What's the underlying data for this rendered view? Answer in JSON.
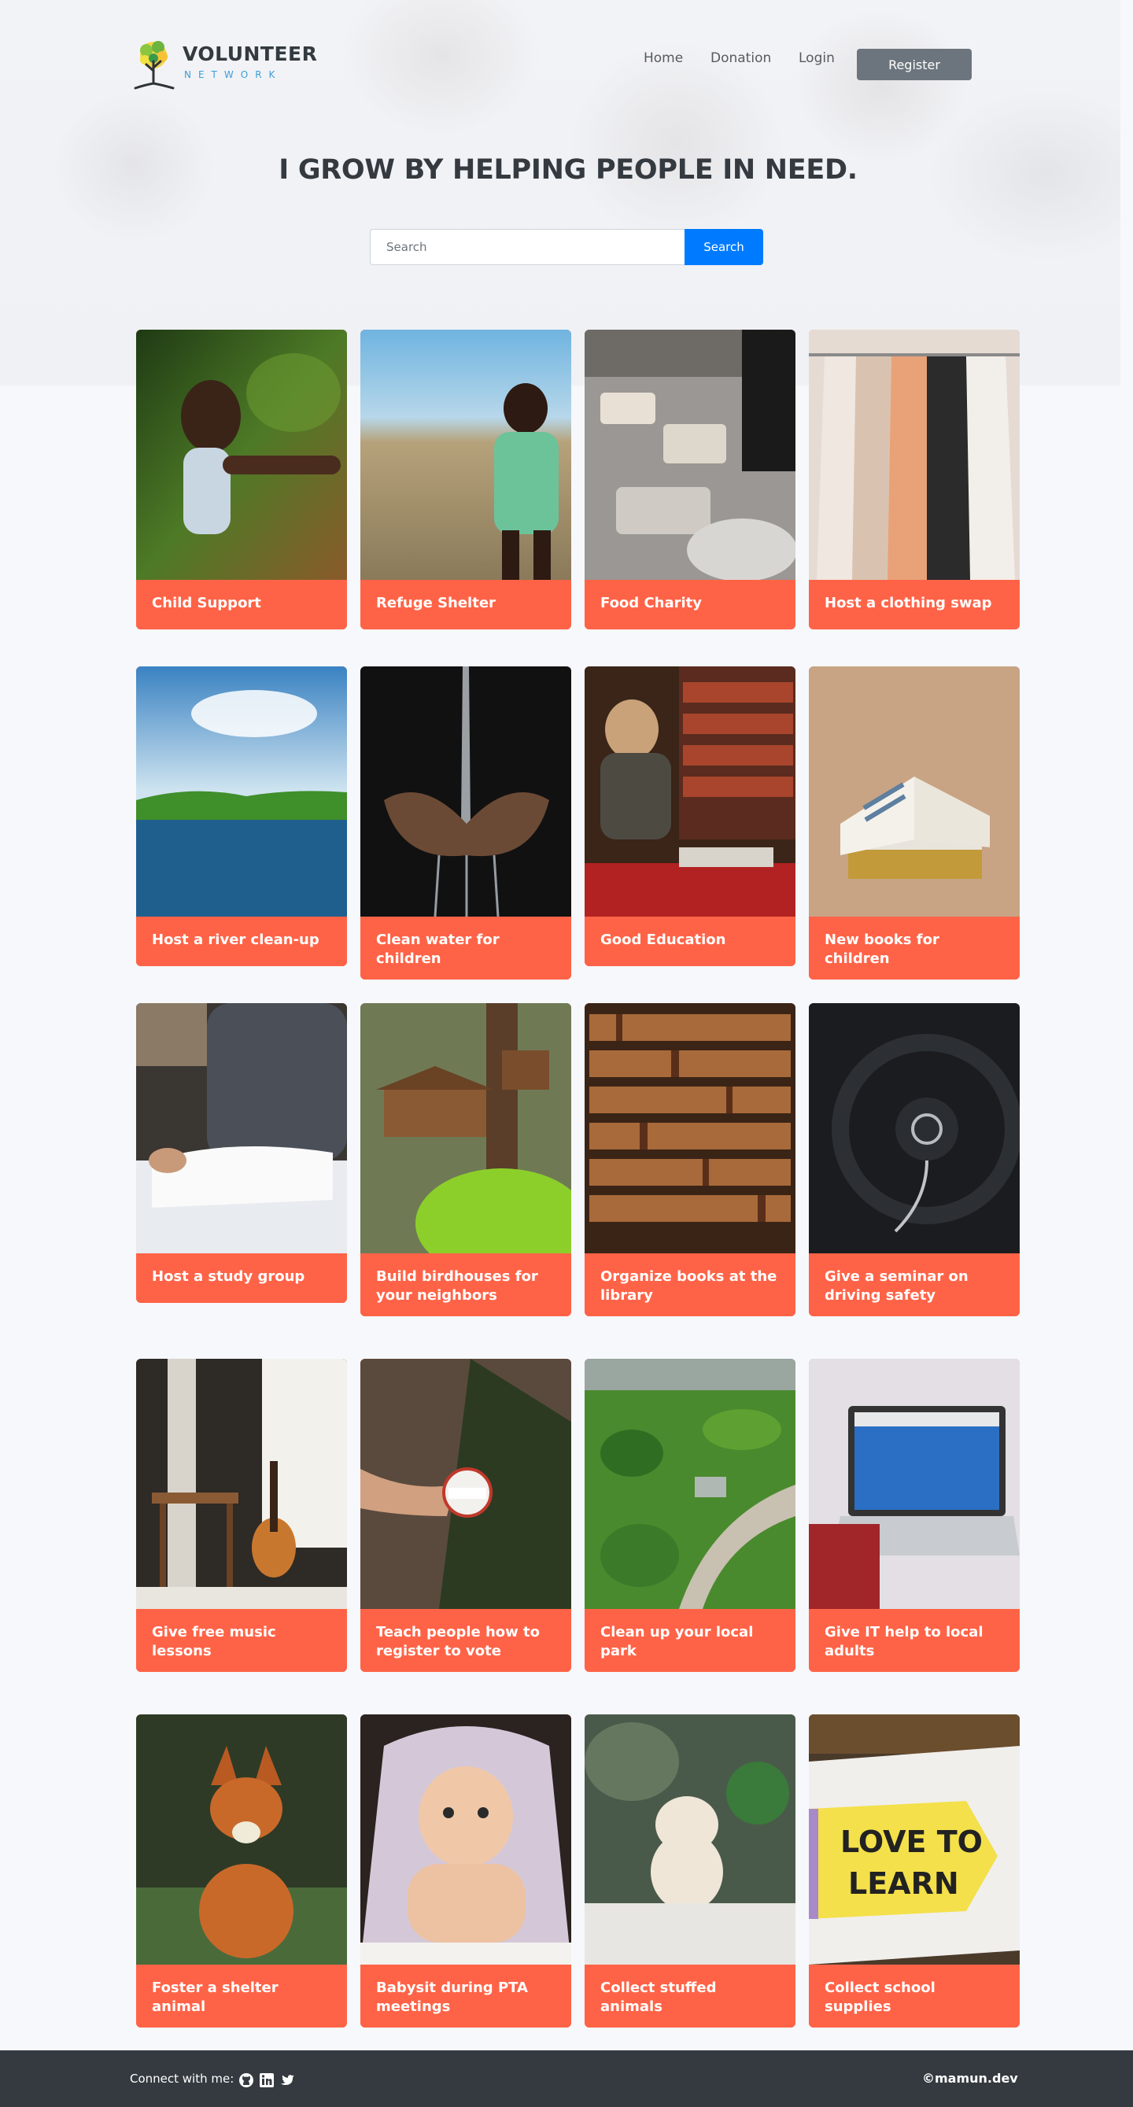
{
  "brand": {
    "name": "VOLUNTEER",
    "tagline": "NETWORK"
  },
  "nav": {
    "items": [
      "Home",
      "Donation",
      "Login"
    ],
    "register_label": "Register"
  },
  "hero": {
    "title": "I GROW BY HELPING PEOPLE IN NEED."
  },
  "search": {
    "placeholder": "Search",
    "button_label": "Search"
  },
  "events": [
    {
      "title": "Child Support",
      "image": "girl outdoors"
    },
    {
      "title": "Refuge Shelter",
      "image": "boy in field"
    },
    {
      "title": "Food Charity",
      "image": "food packing"
    },
    {
      "title": "Host a clothing swap",
      "image": "clothes rack"
    },
    {
      "title": "Host a river clean-up",
      "image": "river landscape"
    },
    {
      "title": "Clean water for children",
      "image": "hands under water"
    },
    {
      "title": "Good Education",
      "image": "boy reading in library"
    },
    {
      "title": "New books for children",
      "image": "stack of books"
    },
    {
      "title": "Host a study group",
      "image": "people studying"
    },
    {
      "title": "Build birdhouses for your neighbors",
      "image": "birdhouses in forest"
    },
    {
      "title": "Organize books at the library",
      "image": "library shelves"
    },
    {
      "title": "Give a seminar on driving safety",
      "image": "steering wheel"
    },
    {
      "title": "Give free music lessons",
      "image": "guitar by window"
    },
    {
      "title": "Teach people how to register to vote",
      "image": "I voted sticker"
    },
    {
      "title": "Clean up your local park",
      "image": "park aerial view"
    },
    {
      "title": "Give IT help to local adults",
      "image": "laptop"
    },
    {
      "title": "Foster a shelter animal",
      "image": "fox"
    },
    {
      "title": "Babysit during PTA meetings",
      "image": "baby under blanket"
    },
    {
      "title": "Collect stuffed animals",
      "image": "puppy"
    },
    {
      "title": "Collect school supplies",
      "image": "love to learn pencil"
    }
  ],
  "footer": {
    "connect_label": "Connect with me:",
    "icons": [
      "github-icon",
      "linkedin-icon",
      "twitter-icon"
    ],
    "credit": "©mamun.dev"
  },
  "colors": {
    "card_accent": "#ff6347",
    "search_button": "#007bff",
    "register_button": "#6c757d",
    "footer_bg": "#343a40"
  }
}
